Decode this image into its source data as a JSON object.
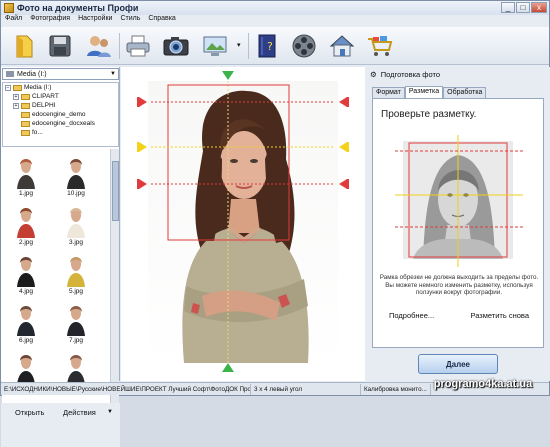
{
  "window": {
    "title": "Фото на документы Профи",
    "minimize": "_",
    "maximize": "□",
    "close": "x"
  },
  "menu": [
    "Файл",
    "Фотография",
    "Настройки",
    "Стиль",
    "Справка"
  ],
  "toolbar": {
    "buttons": [
      "open-icon",
      "save-icon",
      "users-icon",
      "print-icon",
      "camera-icon",
      "display-icon",
      "book-icon",
      "film-icon",
      "home-icon",
      "cart-icon"
    ],
    "dropdown_arrow": "▾"
  },
  "left": {
    "drive_combo": "Media (I:)",
    "tree": [
      {
        "label": "Media (I:)",
        "expanded": true,
        "level": 0
      },
      {
        "label": "CLIPART",
        "expanded": false,
        "level": 1
      },
      {
        "label": "DELPHI",
        "expanded": false,
        "level": 1
      },
      {
        "label": "edocengine_demo",
        "expanded": null,
        "level": 1
      },
      {
        "label": "edocengine_docxeals",
        "expanded": null,
        "level": 1
      },
      {
        "label": "fo...",
        "expanded": null,
        "level": 1
      }
    ],
    "thumbnails": [
      {
        "label": "1.jpg",
        "tone": "#b05a3c",
        "body": "#3d3a38"
      },
      {
        "label": "10.jpg",
        "tone": "#7a4b3a",
        "body": "#2a2a2a"
      },
      {
        "label": "2.jpg",
        "tone": "#8a4b2e",
        "body": "#c43e33"
      },
      {
        "label": "3.jpg",
        "tone": "#d9b89a",
        "body": "#efe6dc"
      },
      {
        "label": "4.jpg",
        "tone": "#6a4430",
        "body": "#1c1c1c"
      },
      {
        "label": "5.jpg",
        "tone": "#c69a6a",
        "body": "#d4b33a"
      },
      {
        "label": "6.jpg",
        "tone": "#6b4a3a",
        "body": "#22262e"
      },
      {
        "label": "7.jpg",
        "tone": "#8c5f47",
        "body": "#23252a"
      },
      {
        "label": "",
        "tone": "#6b4636",
        "body": "#1e1f22"
      },
      {
        "label": "",
        "tone": "#84584a",
        "body": "#2b2c30"
      }
    ],
    "open_button": "Открыть",
    "actions_button": "Действия"
  },
  "right": {
    "header": "Подготовка фото",
    "tabs": [
      "Формат",
      "Разметка",
      "Обработка"
    ],
    "active_tab": 1,
    "heading": "Проверьте разметку.",
    "note": "Рамка обрезки не должна выходить за пределы фото. Вы можете немного изменить разметку, используя ползунки вокруг фотографии.",
    "link_more": "Подробнее...",
    "link_remark": "Разметить снова",
    "next_button": "Далее"
  },
  "status": {
    "path": "E:\\ИСХОДНИКИ\\НОВЫЕ\\Русские\\НОВЕЙШИЕ\\ПРОЕКТ Лучший Софт\\ФотоДОК Профи\\IMAGES\\F...",
    "format": "3 х 4 левый угол",
    "calibration": "Калибровка монито..."
  },
  "watermark": "programo4ka.at.ua",
  "colors": {
    "guide_red": "#e23b3b",
    "guide_yellow": "#f2d21b",
    "handle_green": "#3bb34a",
    "accent": "#5f86b6"
  }
}
